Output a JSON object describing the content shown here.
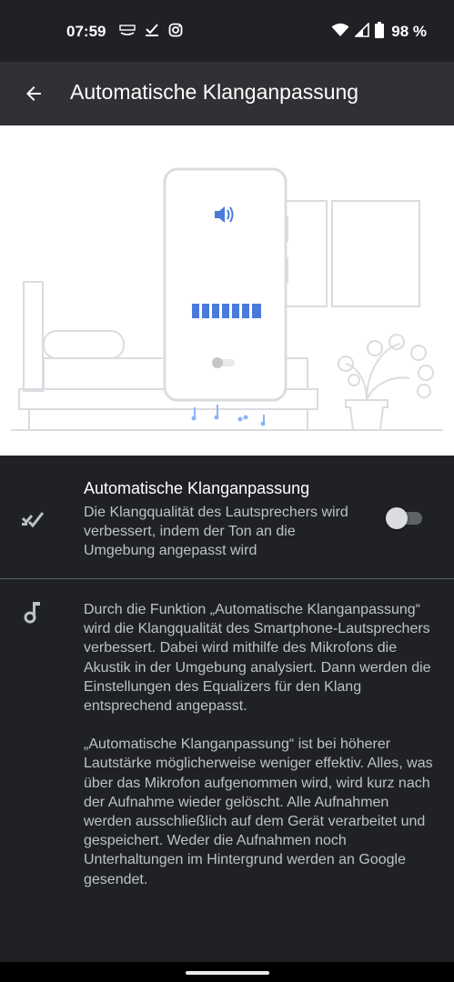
{
  "status_bar": {
    "time": "07:59",
    "battery_percent": "98 %",
    "left_icons": [
      "amazon-icon",
      "task-check-icon",
      "instagram-icon"
    ],
    "right_icons": [
      "wifi-icon",
      "cell-signal-icon",
      "battery-icon"
    ]
  },
  "app_bar": {
    "title": "Automatische Klanganpassung",
    "back_icon": "arrow-back-icon"
  },
  "illustration": {
    "description_icon": "speaker-icon",
    "level_segments": 7
  },
  "setting": {
    "title": "Automatische Klanganpassung",
    "summary": "Die Klangqualität des Lautsprechers wird verbessert, indem der Ton an die Umgebung angepasst wird",
    "enabled": false,
    "icon": "auto-tune-icon"
  },
  "info": {
    "icon": "music-note-icon",
    "paragraph_1": "Durch die Funktion „Automatische Klanganpassung“ wird die Klangqualität des Smartphone-Lautsprechers verbessert. Dabei wird mithilfe des Mikrofons die Akustik in der Umgebung analysiert. Dann werden die Einstellungen des Equalizers für den Klang entsprechend angepasst.",
    "paragraph_2": "„Automatische Klanganpassung“ ist bei höherer Lautstärke möglicherweise weniger effektiv. Alles, was über das Mikrofon aufgenommen wird, wird kurz nach der Aufnahme wieder gelöscht. Alle Aufnahmen werden ausschließlich auf dem Gerät verarbeitet und gespeichert. Weder die Aufnahmen noch Unterhaltungen im Hintergrund werden an Google gesendet."
  },
  "colors": {
    "background": "#202124",
    "app_bar": "#303134",
    "accent_blue": "#4a7bdb",
    "text_primary": "#ffffff",
    "text_secondary": "#bdc1c6"
  }
}
